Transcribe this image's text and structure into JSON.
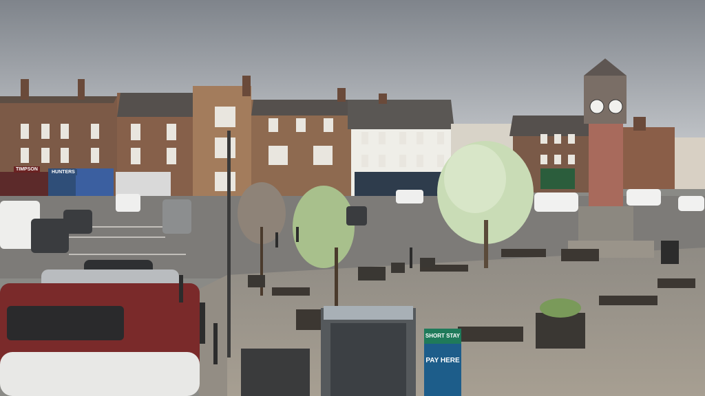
{
  "scene": {
    "signs": {
      "timpsons": "TIMPSON",
      "hunters": "HUNTERS",
      "short_stay": "SHORT STAY",
      "pay_here": "PAY HERE"
    }
  },
  "colors": {
    "sky": "#9aa0a6",
    "brick": "#8a5f49",
    "paving": "#9c958a",
    "tree": "#c9dcb6",
    "sign_green": "#1f7a5a",
    "sign_blue": "#1d5d8a",
    "car_red": "#7a2a2a"
  }
}
